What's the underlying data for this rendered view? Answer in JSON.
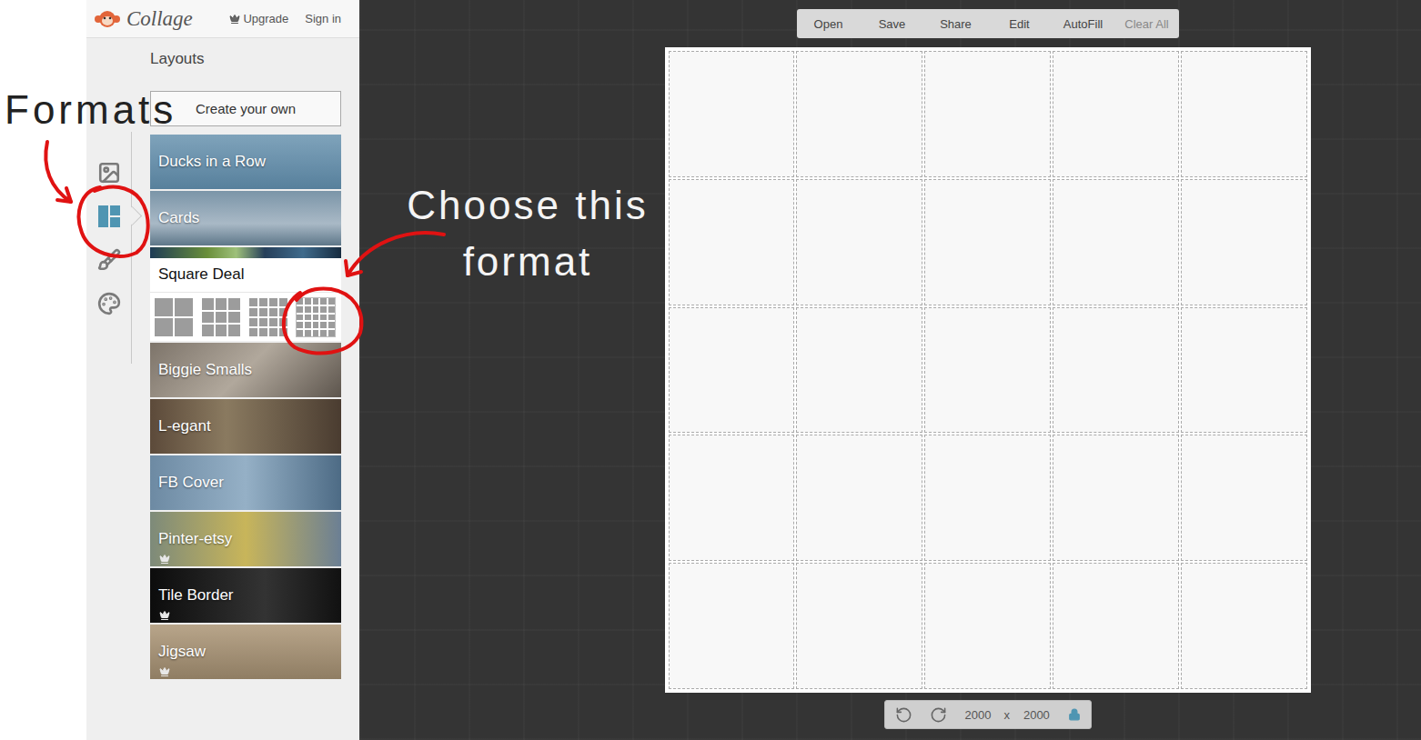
{
  "annotations": {
    "formats_label": "Formats",
    "callout_lines": [
      "Choose this",
      "format"
    ]
  },
  "header": {
    "logo": "Collage",
    "upgrade": "Upgrade",
    "sign_in": "Sign in"
  },
  "sidebar": {
    "title": "Layouts",
    "create_button": "Create your own",
    "tools": [
      {
        "kind": "photos",
        "selected": false
      },
      {
        "kind": "layouts",
        "selected": true
      },
      {
        "kind": "stickers",
        "selected": false
      },
      {
        "kind": "palette",
        "selected": false
      }
    ],
    "layouts": [
      {
        "label": "Ducks in a Row",
        "expanded": false,
        "premium": false
      },
      {
        "label": "Cards",
        "expanded": false,
        "premium": false
      },
      {
        "label": "Square Deal",
        "expanded": true,
        "premium": false,
        "options": [
          {
            "selected": false
          },
          {
            "selected": false
          },
          {
            "selected": false
          },
          {
            "selected": true
          }
        ]
      },
      {
        "label": "Biggie Smalls",
        "expanded": false,
        "premium": false
      },
      {
        "label": "L-egant",
        "expanded": false,
        "premium": false
      },
      {
        "label": "FB Cover",
        "expanded": false,
        "premium": false
      },
      {
        "label": "Pinter-etsy",
        "expanded": false,
        "premium": true
      },
      {
        "label": "Tile Border",
        "expanded": false,
        "premium": true
      },
      {
        "label": "Jigsaw",
        "expanded": false,
        "premium": true
      }
    ]
  },
  "toolbar": {
    "buttons": [
      {
        "label": "Open",
        "disabled": false
      },
      {
        "label": "Save",
        "disabled": false
      },
      {
        "label": "Share",
        "disabled": false
      },
      {
        "label": "Edit",
        "disabled": false
      },
      {
        "label": "AutoFill",
        "disabled": false
      },
      {
        "label": "Clear All",
        "disabled": true
      }
    ]
  },
  "canvas": {
    "width": "2000",
    "separator": "x",
    "height": "2000",
    "locked": true
  }
}
